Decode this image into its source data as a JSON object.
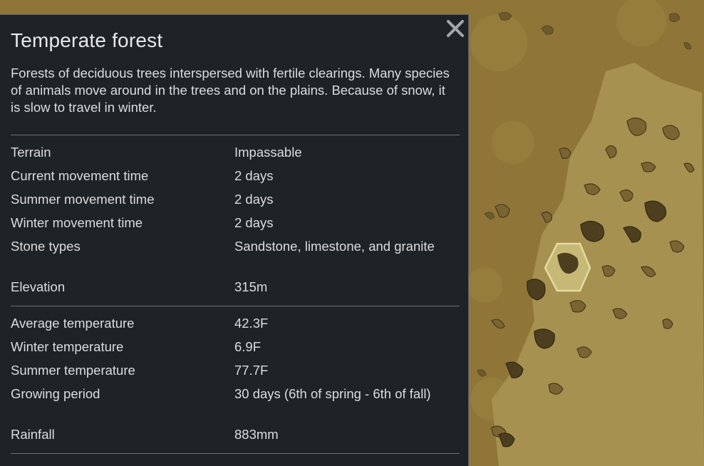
{
  "tile": {
    "title": "Temperate forest",
    "description": "Forests of deciduous trees interspersed with fertile clearings. Many species of animals move around in the trees and on the plains. Because of snow, it is slow to travel in winter."
  },
  "stats_group1": [
    {
      "label": "Terrain",
      "value": "Impassable"
    },
    {
      "label": "Current movement time",
      "value": "2 days"
    },
    {
      "label": "Summer movement time",
      "value": "2 days"
    },
    {
      "label": "Winter movement time",
      "value": "2 days"
    },
    {
      "label": "Stone types",
      "value": "Sandstone, limestone, and granite"
    },
    {
      "label": "Elevation",
      "value": "315m"
    }
  ],
  "stats_group2": [
    {
      "label": "Average temperature",
      "value": "42.3F"
    },
    {
      "label": "Winter temperature",
      "value": "6.9F"
    },
    {
      "label": "Summer temperature",
      "value": "77.7F"
    },
    {
      "label": "Growing period",
      "value": "30 days (6th of spring - 6th of fall)"
    },
    {
      "label": "Rainfall",
      "value": "883mm"
    }
  ],
  "colors": {
    "panel_bg": "#1e2328",
    "text": "#dcdcdc",
    "map_base": "#8f7638",
    "highlight": "#c9be7a"
  },
  "icons": {
    "close": "close-icon"
  }
}
